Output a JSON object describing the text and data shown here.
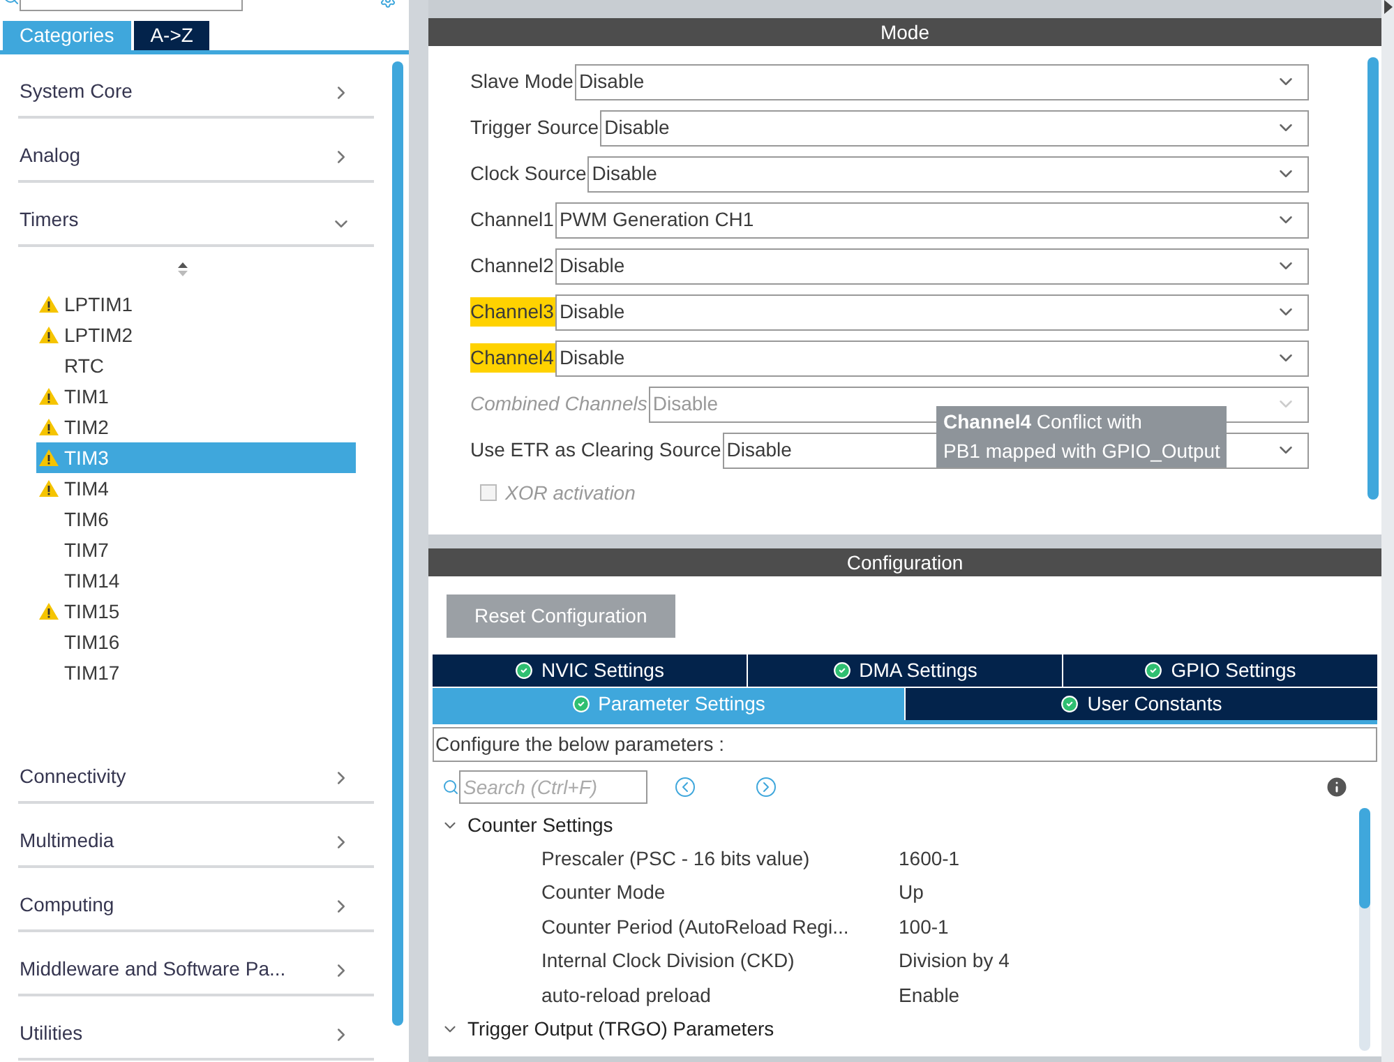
{
  "sidebar": {
    "tabs": [
      {
        "label": "Categories",
        "selected": true
      },
      {
        "label": "A->Z",
        "selected": false
      }
    ],
    "categories": [
      {
        "label": "System Core",
        "expanded": false
      },
      {
        "label": "Analog",
        "expanded": false
      },
      {
        "label": "Timers",
        "expanded": true,
        "children": [
          {
            "label": "LPTIM1",
            "warning": true,
            "selected": false
          },
          {
            "label": "LPTIM2",
            "warning": true,
            "selected": false
          },
          {
            "label": "RTC",
            "warning": false,
            "selected": false
          },
          {
            "label": "TIM1",
            "warning": true,
            "selected": false
          },
          {
            "label": "TIM2",
            "warning": true,
            "selected": false
          },
          {
            "label": "TIM3",
            "warning": true,
            "selected": true
          },
          {
            "label": "TIM4",
            "warning": true,
            "selected": false
          },
          {
            "label": "TIM6",
            "warning": false,
            "selected": false
          },
          {
            "label": "TIM7",
            "warning": false,
            "selected": false
          },
          {
            "label": "TIM14",
            "warning": false,
            "selected": false
          },
          {
            "label": "TIM15",
            "warning": true,
            "selected": false
          },
          {
            "label": "TIM16",
            "warning": false,
            "selected": false
          },
          {
            "label": "TIM17",
            "warning": false,
            "selected": false
          }
        ]
      },
      {
        "label": "Connectivity",
        "expanded": false
      },
      {
        "label": "Multimedia",
        "expanded": false
      },
      {
        "label": "Computing",
        "expanded": false
      },
      {
        "label": "Middleware and Software Pa...",
        "expanded": false
      },
      {
        "label": "Utilities",
        "expanded": false
      }
    ]
  },
  "mode": {
    "title": "Mode",
    "rows": [
      {
        "label": "Slave Mode",
        "value": "Disable",
        "warning": false,
        "disabled": false
      },
      {
        "label": "Trigger Source",
        "value": "Disable",
        "warning": false,
        "disabled": false
      },
      {
        "label": "Clock Source",
        "value": "Disable",
        "warning": false,
        "disabled": false
      },
      {
        "label": "Channel1",
        "value": "PWM Generation CH1",
        "warning": false,
        "disabled": false
      },
      {
        "label": "Channel2",
        "value": "Disable",
        "warning": false,
        "disabled": false
      },
      {
        "label": "Channel3",
        "value": "Disable",
        "warning": true,
        "disabled": false
      },
      {
        "label": "Channel4",
        "value": "Disable",
        "warning": true,
        "disabled": false
      },
      {
        "label": "Combined Channels",
        "value": "Disable",
        "warning": false,
        "disabled": true
      },
      {
        "label": "Use ETR as Clearing Source",
        "value": "Disable",
        "warning": false,
        "disabled": false
      }
    ],
    "checkboxes": [
      {
        "label": "XOR activation",
        "checked": false,
        "disabled": true
      }
    ],
    "tooltip": {
      "lines": [
        "**Channel4** Conflict with",
        "PB1 mapped with GPIO_Output"
      ]
    }
  },
  "configuration": {
    "title": "Configuration",
    "reset_button": "Reset Configuration",
    "tab_rows": [
      [
        {
          "label": "NVIC Settings",
          "selected": false
        },
        {
          "label": "DMA Settings",
          "selected": false
        },
        {
          "label": "GPIO Settings",
          "selected": false
        }
      ],
      [
        {
          "label": "Parameter Settings",
          "selected": true
        },
        {
          "label": "User Constants",
          "selected": false
        }
      ]
    ],
    "description": "Configure the below parameters :",
    "search": {
      "placeholder": "Search (Ctrl+F)"
    },
    "groups": [
      {
        "label": "Counter Settings",
        "expanded": true,
        "children": [
          {
            "name": "Prescaler (PSC - 16 bits value)",
            "value": "1600-1"
          },
          {
            "name": "Counter Mode",
            "value": "Up"
          },
          {
            "name": "Counter Period (AutoReload Regi...",
            "value": "100-1"
          },
          {
            "name": "Internal Clock Division (CKD)",
            "value": "Division by 4"
          },
          {
            "name": "auto-reload preload",
            "value": "Enable"
          }
        ]
      },
      {
        "label": "Trigger Output (TRGO) Parameters",
        "expanded": true
      }
    ]
  }
}
